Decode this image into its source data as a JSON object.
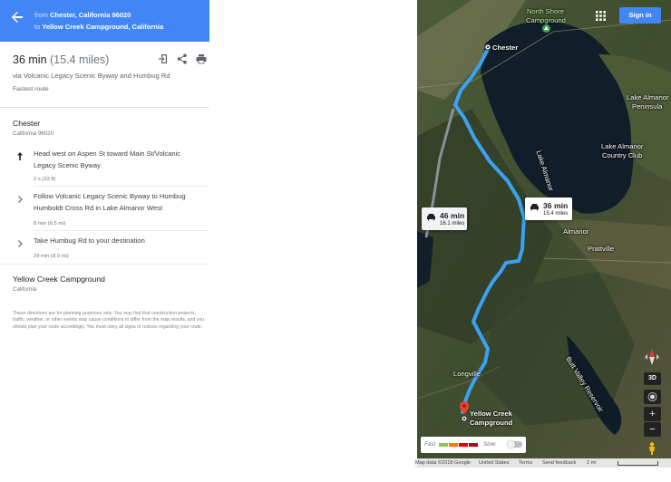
{
  "header": {
    "from_prefix": "from",
    "from_place": "Chester, California 96020",
    "to_prefix": "to",
    "to_place": "Yellow Creek Campground, California"
  },
  "summary": {
    "duration": "36 min",
    "distance": "(15.4 miles)",
    "via": "via Volcanic Legacy Scenic Byway and Humbug Rd",
    "note": "Fastest route",
    "icons": [
      "send-to-device-icon",
      "share-icon",
      "print-icon"
    ]
  },
  "start": {
    "title": "Chester",
    "subtitle": "California 96020"
  },
  "steps": [
    {
      "icon": "straight-arrow-icon",
      "text": "Head west on Aspen St toward Main St/Volcanic Legacy Scenic Byway",
      "meta": "2 s (33 ft)"
    },
    {
      "icon": "chevron-right-icon",
      "text": "Follow Volcanic Legacy Scenic Byway to Humbug Humboldt Cross Rd in Lake Almanor West",
      "meta": "8 min (6.5 mi)"
    },
    {
      "icon": "chevron-right-icon",
      "text": "Take Humbug Rd to your destination",
      "meta": "29 min (8.9 mi)"
    }
  ],
  "end": {
    "title": "Yellow Creek Campground",
    "subtitle": "California"
  },
  "disclaimer": "These directions are for planning purposes only. You may find that construction projects, traffic, weather, or other events may cause conditions to differ from the map results, and you should plan your route accordingly. You must obey all signs or notices regarding your route.",
  "map": {
    "sign_in": "Sign in",
    "labels": {
      "north_shore": "North Shore",
      "campground": "Campground",
      "chester": "Chester",
      "lake_almanor_pen_1": "Lake Almanor",
      "lake_almanor_pen_2": "Peninsula",
      "lake_almanor_vertical": "Lake Almanor",
      "country_club_1": "Lake Almanor",
      "country_club_2": "Country Club",
      "almanor": "Almanor",
      "prattville": "Prattville",
      "butt_valley": "Butt Valley Reservoir",
      "longville": "Longville",
      "dest_1": "Yellow Creek",
      "dest_2": "Campground"
    },
    "route_primary": {
      "time": "36 min",
      "dist": "15.4 miles"
    },
    "route_alt": {
      "time": "46 min",
      "dist": "16.1 miles"
    },
    "traffic": {
      "fast": "Fast",
      "slow": "Slow",
      "colors": [
        "#84ca50",
        "#f07d02",
        "#e60000",
        "#9e1313"
      ]
    },
    "controls": {
      "three_d": "3D",
      "zoom_in": "+",
      "zoom_out": "−"
    },
    "footer": {
      "data": "Map data ©2018 Google",
      "us": "United States",
      "terms": "Terms",
      "feedback": "Send feedback",
      "scale": "2 mi"
    }
  },
  "colors": {
    "header": "#4285f4",
    "route": "#3aa2f2",
    "dest_pin": "#ea4335"
  }
}
